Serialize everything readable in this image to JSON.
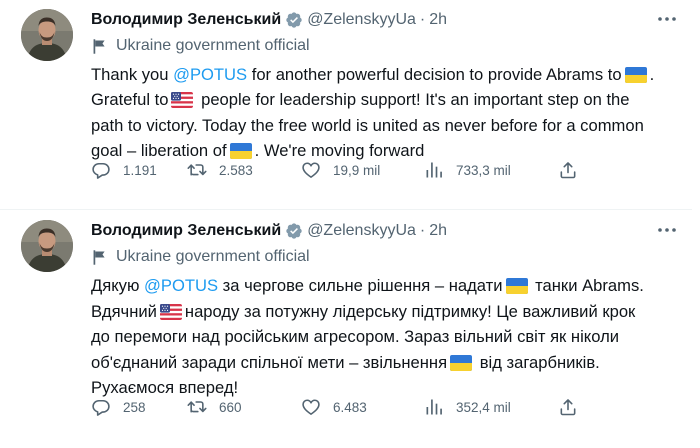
{
  "tweets": [
    {
      "author": {
        "name": "Володимир Зеленський",
        "handle": "@ZelenskyyUa",
        "time": "2h",
        "avatar": "avatar-photo"
      },
      "separator": "·",
      "label": {
        "icon": "government-flag-icon",
        "text": "Ukraine government official"
      },
      "body": {
        "l1a": "Thank you ",
        "mention": "@POTUS",
        "l1b": " for another powerful decision to provide Abrams to",
        "l2a": "Grateful to",
        "l2b": " people for leadership support! It's an important step on the",
        "l3": "path to victory. Today the free world is united as never before for a common",
        "l4a": "goal – liberation of",
        "l4b": ". We're moving forward"
      },
      "stats": {
        "replies": "1.191",
        "retweets": "2.583",
        "likes": "19,9 mil",
        "views": "733,3 mil"
      }
    },
    {
      "author": {
        "name": "Володимир Зеленський",
        "handle": "@ZelenskyyUa",
        "time": "2h",
        "avatar": "avatar-photo"
      },
      "separator": "·",
      "label": {
        "icon": "government-flag-icon",
        "text": "Ukraine government official"
      },
      "body": {
        "l1a": "Дякую ",
        "mention": "@POTUS",
        "l1b": " за чергове сильне рішення – надати",
        "l1c": " танки Abrams.",
        "l2a": "Вдячний",
        "l2b": "народу за потужну лідерську підтримку! Це важливий крок",
        "l3": "до перемоги над російським агресором. Зараз вільний світ як ніколи",
        "l4a": "об'єднаний заради спільної мети – звільнення",
        "l4b": " від загарбників.",
        "l5": "Рухаємося вперед!"
      },
      "stats": {
        "replies": "258",
        "retweets": "660",
        "likes": "6.483",
        "views": "352,4 mil"
      }
    }
  ],
  "colors": {
    "accent": "#1d9bf0",
    "text": "#0f1419",
    "secondary": "#536471",
    "border": "#eff3f4"
  },
  "icons": [
    "verified-badge-icon",
    "more-options-icon",
    "government-flag-icon",
    "reply-icon",
    "retweet-icon",
    "like-icon",
    "views-icon",
    "share-icon",
    "ukraine-flag-emoji",
    "us-flag-emoji"
  ]
}
